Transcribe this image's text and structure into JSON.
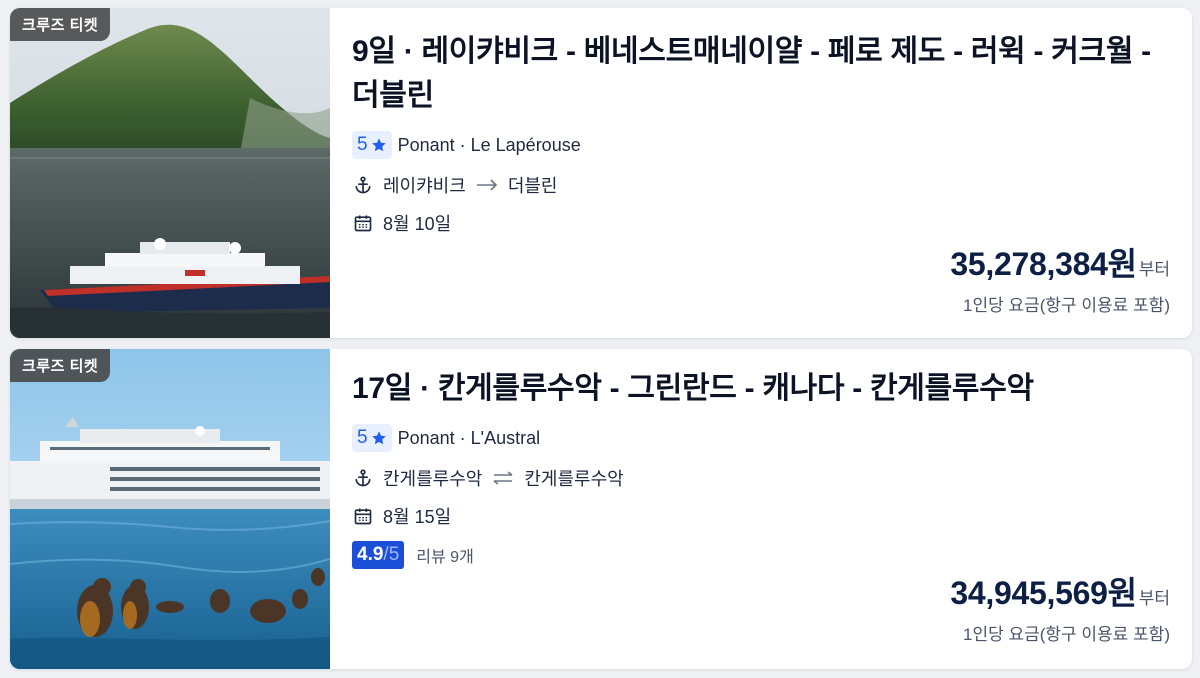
{
  "cards": [
    {
      "badge": "크루즈 티켓",
      "title": "9일 · 레이캬비크 - 베네스트매네이얄 - 페로 제도 - 러윅 - 커크월 - 더블린",
      "stars": "5",
      "ship": "Ponant · Le Lapérouse",
      "from_port": "레이캬비크",
      "to_port": "더블린",
      "route_icon": "arrow-right-icon",
      "date": "8월 10일",
      "price": "35,278,384원",
      "price_suffix": "부터",
      "price_note": "1인당 요금(항구 이용료 포함)"
    },
    {
      "badge": "크루즈 티켓",
      "title": "17일 · 칸게를루수악 - 그린란드 - 캐나다 - 칸게를루수악",
      "stars": "5",
      "ship": "Ponant · L'Austral",
      "from_port": "칸게를루수악",
      "to_port": "칸게를루수악",
      "route_icon": "round-trip-icon",
      "date": "8월 15일",
      "score": "4.9",
      "score_max": "/5",
      "reviews": "리뷰 9개",
      "price": "34,945,569원",
      "price_suffix": "부터",
      "price_note": "1인당 요금(항구 이용료 포함)"
    }
  ],
  "colors": {
    "accent": "#1f5ff0",
    "score_bg": "#1c4fd8",
    "price": "#0e1f45"
  }
}
